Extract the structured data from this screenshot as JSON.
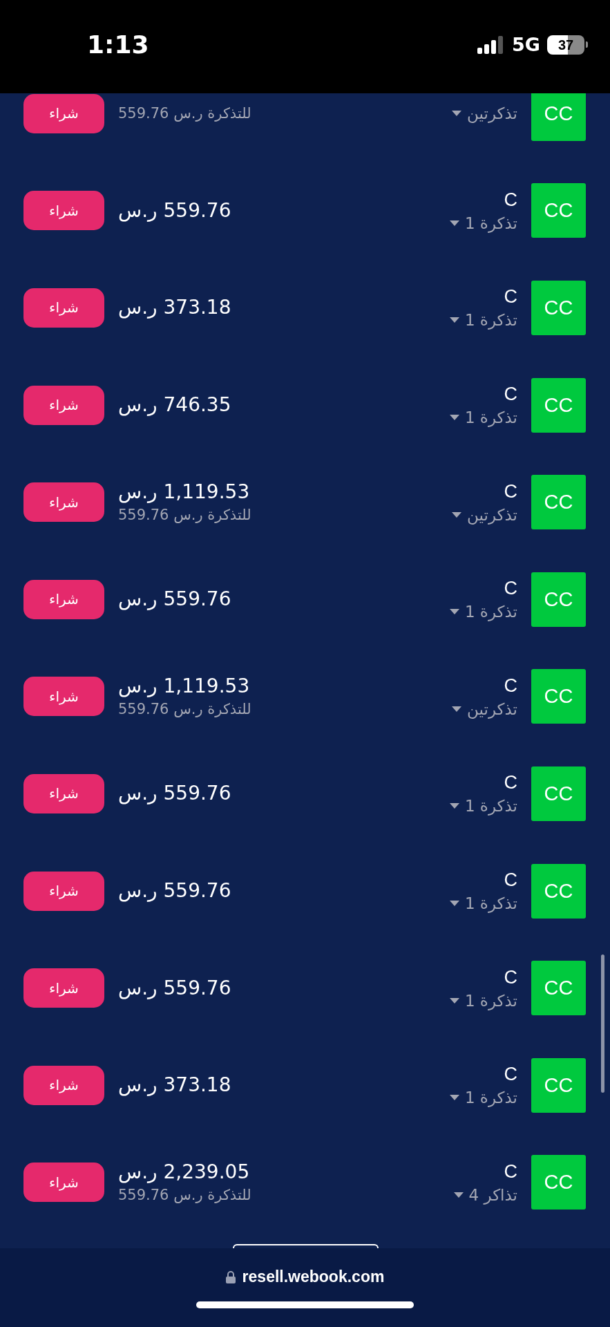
{
  "status_bar": {
    "time": "1:13",
    "network": "5G",
    "battery": "37"
  },
  "listings": [
    {
      "tag": "CC",
      "quantity": "تذكرتين",
      "per_ticket": "للتذكرة ر.س 559.76",
      "button": "شراء"
    },
    {
      "tag": "CC",
      "section": "C",
      "quantity": "1 تذكرة",
      "price": "559.76 ر.س",
      "button": "شراء"
    },
    {
      "tag": "CC",
      "section": "C",
      "quantity": "1 تذكرة",
      "price": "373.18 ر.س",
      "button": "شراء"
    },
    {
      "tag": "CC",
      "section": "C",
      "quantity": "1 تذكرة",
      "price": "746.35 ر.س",
      "button": "شراء"
    },
    {
      "tag": "CC",
      "section": "C",
      "quantity": "تذكرتين",
      "price": "1,119.53 ر.س",
      "per_ticket": "للتذكرة ر.س 559.76",
      "button": "شراء"
    },
    {
      "tag": "CC",
      "section": "C",
      "quantity": "1 تذكرة",
      "price": "559.76 ر.س",
      "button": "شراء"
    },
    {
      "tag": "CC",
      "section": "C",
      "quantity": "تذكرتين",
      "price": "1,119.53 ر.س",
      "per_ticket": "للتذكرة ر.س 559.76",
      "button": "شراء"
    },
    {
      "tag": "CC",
      "section": "C",
      "quantity": "1 تذكرة",
      "price": "559.76 ر.س",
      "button": "شراء"
    },
    {
      "tag": "CC",
      "section": "C",
      "quantity": "1 تذكرة",
      "price": "559.76 ر.س",
      "button": "شراء"
    },
    {
      "tag": "CC",
      "section": "C",
      "quantity": "1 تذكرة",
      "price": "559.76 ر.س",
      "button": "شراء"
    },
    {
      "tag": "CC",
      "section": "C",
      "quantity": "1 تذكرة",
      "price": "373.18 ر.س",
      "button": "شراء"
    },
    {
      "tag": "CC",
      "section": "C",
      "quantity": "4 تذاكر",
      "price": "2,239.05 ر.س",
      "per_ticket": "للتذكرة ر.س 559.76",
      "button": "شراء"
    }
  ],
  "browser_bar": {
    "url": "resell.webook.com"
  }
}
